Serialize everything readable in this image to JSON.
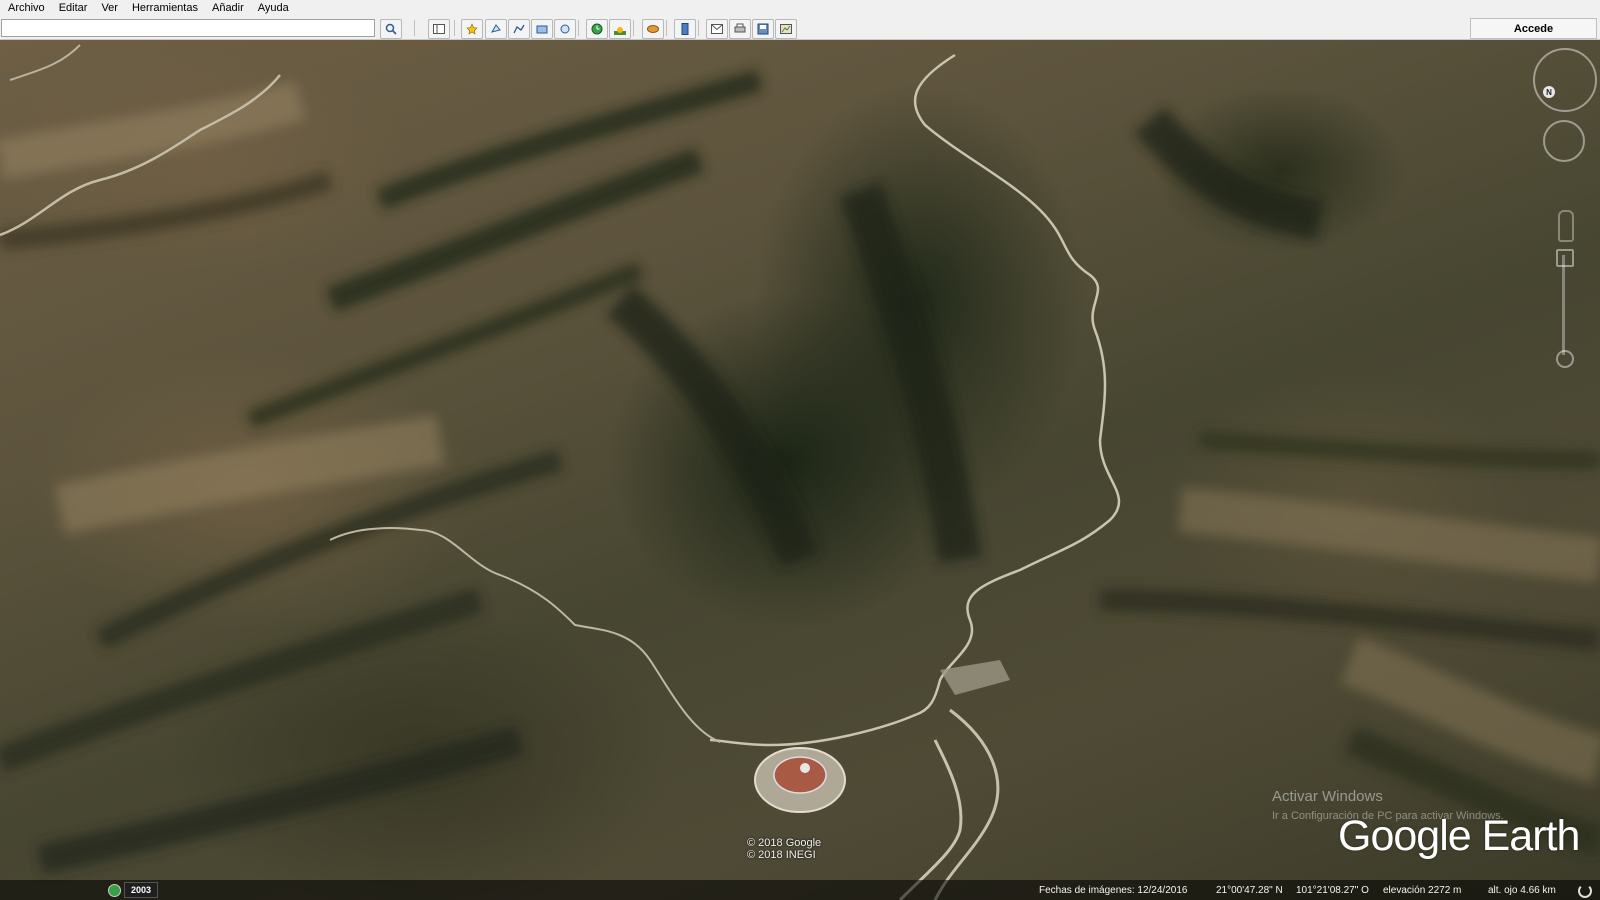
{
  "menubar": {
    "items": [
      "Archivo",
      "Editar",
      "Ver",
      "Herramientas",
      "Añadir",
      "Ayuda"
    ]
  },
  "toolbar": {
    "search_value": "",
    "buttons": [
      {
        "name": "search-icon"
      },
      {
        "name": "sidebar-toggle-icon"
      },
      {
        "name": "add-placemark-icon"
      },
      {
        "name": "add-polygon-icon"
      },
      {
        "name": "add-path-icon"
      },
      {
        "name": "add-image-overlay-icon"
      },
      {
        "name": "record-tour-icon"
      },
      {
        "name": "historical-imagery-icon"
      },
      {
        "name": "sunlight-icon"
      },
      {
        "name": "switch-planet-icon"
      },
      {
        "name": "ruler-icon"
      },
      {
        "name": "email-icon"
      },
      {
        "name": "print-icon"
      },
      {
        "name": "save-image-icon"
      },
      {
        "name": "view-in-maps-icon"
      }
    ],
    "signin_label": "Accede"
  },
  "map": {
    "north_label": "N",
    "watermark_title": "Activar Windows",
    "watermark_sub": "Ir a Configuración de PC para activar Windows.",
    "logo": "Google Earth",
    "copyright": [
      "© 2018 Google",
      "© 2018 INEGI"
    ]
  },
  "status": {
    "year": "2003",
    "imagery_date": "Fechas de imágenes: 12/24/2016",
    "latitude": "21°00'47.28\" N",
    "longitude": "101°21'08.27\" O",
    "elevation": "elevación  2272 m",
    "eye_altitude": "alt. ojo   4.66 km"
  },
  "colors": {
    "terrain_dark": "#2f3322",
    "terrain_light": "#6e5f45",
    "road": "#c9c4b3"
  }
}
